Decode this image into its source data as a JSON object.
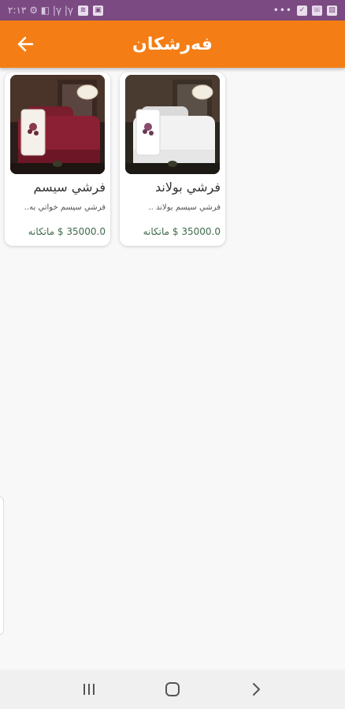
{
  "status_bar": {
    "left_text": "۲:۱۳ ⚙ ◧ |γ |γ",
    "right_dots": "•••"
  },
  "app_bar": {
    "title": "فەرشکان",
    "back_icon": "arrow-left-icon"
  },
  "products": [
    {
      "name": "فرشي بولاند",
      "description": "فرشي سيسم بولاند ..",
      "price": "35000.0 $ ماتكانه",
      "image_icon": "bedding-white-image"
    },
    {
      "name": "فرشي سيسم",
      "description": "فرشي سيسم خواتي به..",
      "price": "35000.0 $ ماتكانه",
      "image_icon": "bedding-burgundy-image"
    }
  ],
  "nav_bar": {
    "recents_icon": "recents-icon",
    "home_icon": "home-icon",
    "back_icon": "back-chevron-icon"
  },
  "colors": {
    "status_bar": "#7b4a83",
    "app_bar": "#f47e15",
    "price": "#3f6a4b",
    "background": "#f8f8f8"
  }
}
